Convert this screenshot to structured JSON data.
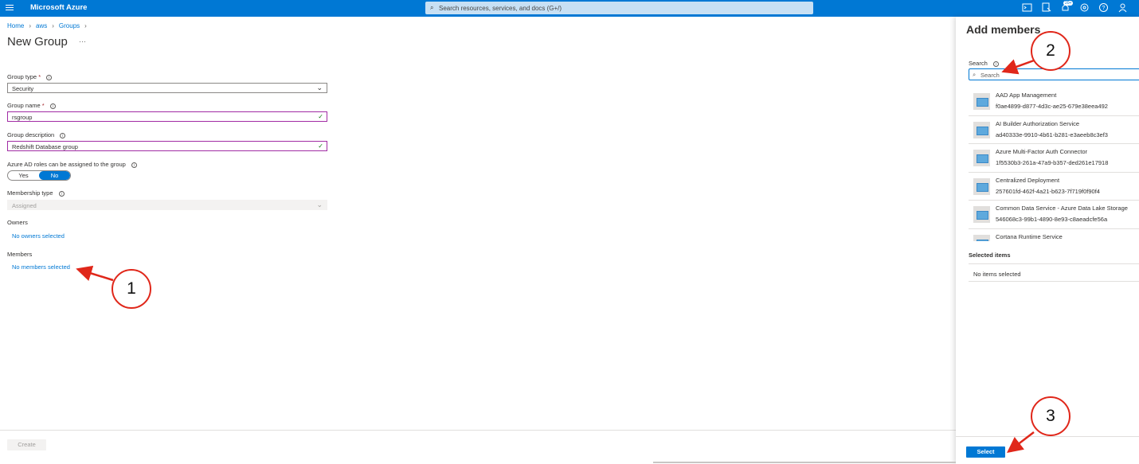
{
  "topbar": {
    "brand": "Microsoft Azure",
    "search_placeholder": "Search resources, services, and docs (G+/)",
    "notification_count": "20+"
  },
  "breadcrumb": [
    "Home",
    "aws",
    "Groups"
  ],
  "page": {
    "title": "New Group",
    "ellipsis": "···"
  },
  "form": {
    "group_type_label": "Group type",
    "group_type_value": "Security",
    "group_name_label": "Group name",
    "group_name_value": "rsgroup",
    "group_description_label": "Group description",
    "group_description_value": "Redshift Database group",
    "ad_roles_label": "Azure AD roles can be assigned to the group",
    "ad_roles_yes": "Yes",
    "ad_roles_no": "No",
    "membership_type_label": "Membership type",
    "membership_type_value": "Assigned",
    "owners_label": "Owners",
    "owners_link": "No owners selected",
    "members_label": "Members",
    "members_link": "No members selected",
    "required_mark": "*",
    "create_label": "Create"
  },
  "panel": {
    "title": "Add members",
    "search_label": "Search",
    "search_placeholder": "Search",
    "members": [
      {
        "name": "AAD App Management",
        "id": "f0ae4899-d877-4d3c-ae25-679e38eea492"
      },
      {
        "name": "AI Builder Authorization Service",
        "id": "ad40333e-9910-4b61-b281-e3aeeb8c3ef3"
      },
      {
        "name": "Azure Multi-Factor Auth Connector",
        "id": "1f5530b3-261a-47a9-b357-ded261e17918"
      },
      {
        "name": "Centralized Deployment",
        "id": "257601fd-462f-4a21-b623-7f719f0f90f4"
      },
      {
        "name": "Common Data Service - Azure Data Lake Storage",
        "id": "546068c3-99b1-4890-8e93-c8aeadcfe56a"
      },
      {
        "name": "Cortana Runtime Service",
        "id": ""
      }
    ],
    "selected_items_label": "Selected items",
    "no_items_label": "No items selected",
    "select_label": "Select"
  },
  "callouts": [
    "1",
    "2",
    "3"
  ],
  "colors": {
    "accent": "#0078d4",
    "callout_red": "#e0271a",
    "valid_border": "#a12ca4"
  }
}
